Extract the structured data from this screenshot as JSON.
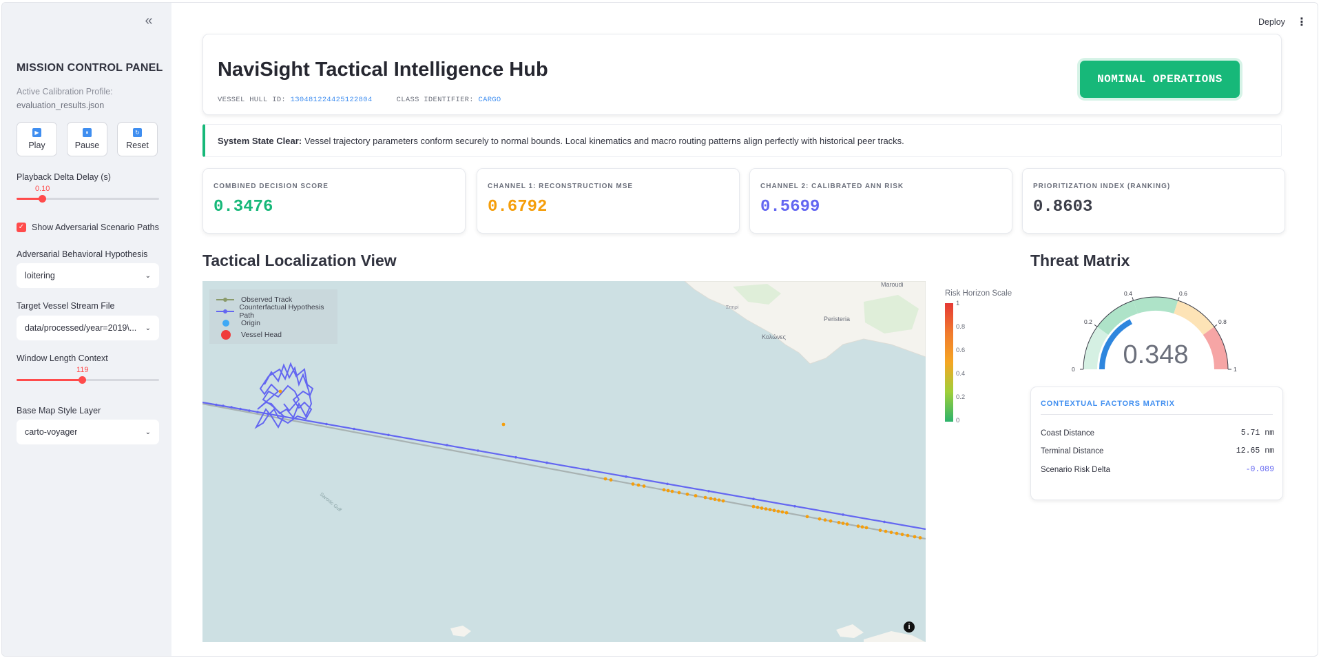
{
  "sidebar": {
    "collapse_glyph": "«",
    "title": "MISSION CONTROL PANEL",
    "profile_label": "Active Calibration Profile:",
    "profile_value": "evaluation_results.json",
    "buttons": [
      {
        "label": "Play",
        "icon": "play-icon",
        "glyph": "▶"
      },
      {
        "label": "Pause",
        "icon": "pause-icon",
        "glyph": "⏸"
      },
      {
        "label": "Reset",
        "icon": "reset-icon",
        "glyph": "↻"
      }
    ],
    "playback": {
      "label": "Playback Delta Delay (s)",
      "value": "0.10",
      "fraction": 0.18
    },
    "adversarial_checkbox": {
      "label": "Show Adversarial Scenario Paths",
      "checked": true
    },
    "hypothesis": {
      "label": "Adversarial Behavioral Hypothesis",
      "value": "loitering"
    },
    "stream_file": {
      "label": "Target Vessel Stream File",
      "value": "data/processed/year=2019\\..."
    },
    "window": {
      "label": "Window Length Context",
      "value": "119",
      "fraction": 0.46
    },
    "map_style": {
      "label": "Base Map Style Layer",
      "value": "carto-voyager"
    }
  },
  "toolbar": {
    "deploy_label": "Deploy",
    "menu_glyph": "⋮"
  },
  "header": {
    "title": "NaviSight Tactical Intelligence Hub",
    "hull_label": "VESSEL HULL ID:",
    "hull_value": "130481224425122804",
    "class_label": "CLASS IDENTIFIER:",
    "class_value": "CARGO",
    "status_badge": "NOMINAL OPERATIONS"
  },
  "state_banner": {
    "bold": "System State Clear:",
    "text": "Vessel trajectory parameters conform securely to normal bounds. Local kinematics and macro routing patterns align perfectly with historical peer tracks."
  },
  "metrics": [
    {
      "label": "COMBINED DECISION SCORE",
      "value": "0.3476",
      "color": "#17b879"
    },
    {
      "label": "CHANNEL 1: RECONSTRUCTION MSE",
      "value": "0.6792",
      "color": "#f59e0b"
    },
    {
      "label": "CHANNEL 2: CALIBRATED ANN RISK",
      "value": "0.5699",
      "color": "#6366f1"
    },
    {
      "label": "PRIORITIZATION INDEX (RANKING)",
      "value": "0.8603",
      "color": "#3d3f4a"
    }
  ],
  "map_section": {
    "title": "Tactical Localization View",
    "legend": [
      "Observed Track",
      "Counterfactual Hypothesis Path",
      "Origin",
      "Vessel Head"
    ],
    "place_labels": {
      "maroudi": "Maroudi",
      "peristeria": "Peristeria",
      "kolones": "Κολώνες",
      "sipri": "Σπηρί",
      "gulf": "Saronic Gulf"
    },
    "colorbar_title": "Risk Horizon Scale",
    "colorbar_ticks": [
      "1",
      "0.8",
      "0.6",
      "0.4",
      "0.2",
      "0"
    ],
    "info_glyph": "i"
  },
  "threat_section": {
    "title": "Threat Matrix",
    "gauge": {
      "value": 0.348,
      "display": "0.348",
      "ticks": [
        "0",
        "0.2",
        "0.4",
        "0.6",
        "0.8",
        "1"
      ]
    },
    "context_title": "CONTEXTUAL FACTORS MATRIX",
    "context_rows": [
      {
        "key": "Coast Distance",
        "value": "5.71 nm"
      },
      {
        "key": "Terminal Distance",
        "value": "12.65 nm"
      },
      {
        "key": "Scenario Risk Delta",
        "value": "-0.089"
      }
    ]
  },
  "colors": {
    "accent_red": "#ff4b4b",
    "accent_green": "#17b879",
    "accent_blue": "#3f8ef0",
    "hypothesis_path": "#6366f1",
    "observed_track": "#a8b2b2",
    "risk_point": "#f59e0b"
  }
}
